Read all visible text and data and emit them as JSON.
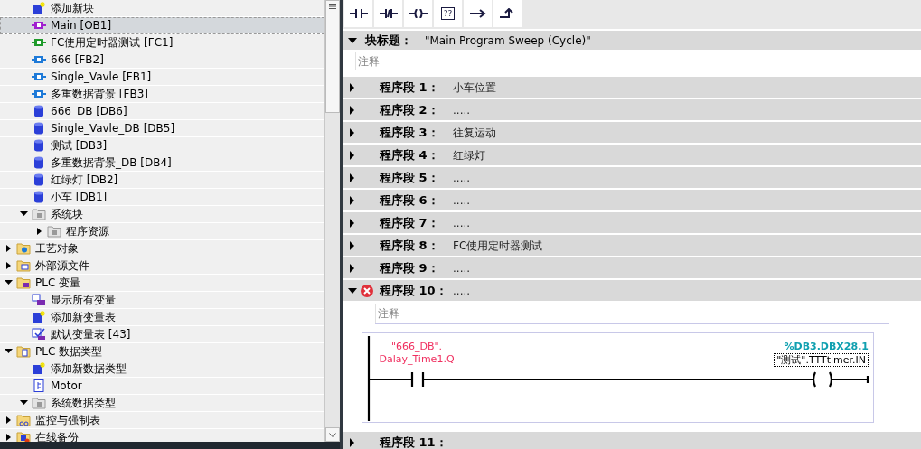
{
  "tree": {
    "partial_group": [
      {
        "kind": "add",
        "label": "添加新块",
        "selected": false
      },
      {
        "kind": "ob",
        "label": "Main [OB1]",
        "selected": true
      },
      {
        "kind": "fc",
        "label": "FC使用定时器测试 [FC1]",
        "selected": false
      },
      {
        "kind": "fb",
        "label": "666 [FB2]",
        "selected": false
      },
      {
        "kind": "fb",
        "label": "Single_Vavle [FB1]",
        "selected": false
      },
      {
        "kind": "fb",
        "label": "多重数据背景 [FB3]",
        "selected": false
      },
      {
        "kind": "db",
        "label": "666_DB [DB6]",
        "selected": false
      },
      {
        "kind": "db",
        "label": "Single_Vavle_DB [DB5]",
        "selected": false
      },
      {
        "kind": "db",
        "label": "测试 [DB3]",
        "selected": false
      },
      {
        "kind": "db",
        "label": "多重数据背景_DB [DB4]",
        "selected": false
      },
      {
        "kind": "db",
        "label": "红绿灯 [DB2]",
        "selected": false
      },
      {
        "kind": "db",
        "label": "小车 [DB1]",
        "selected": false
      },
      {
        "kind": "sysfolder",
        "label": "系统块",
        "selected": false,
        "expanded": true,
        "children": [
          {
            "kind": "sysfolder",
            "label": "程序资源",
            "selected": false,
            "expanded": false
          }
        ]
      }
    ],
    "items": [
      {
        "kind": "techfolder",
        "label": "工艺对象",
        "selected": false,
        "expanded": false
      },
      {
        "kind": "extfolder",
        "label": "外部源文件",
        "selected": false,
        "expanded": false
      },
      {
        "kind": "tagfolder",
        "label": "PLC 变量",
        "selected": false,
        "expanded": true,
        "children": [
          {
            "kind": "showtags",
            "label": "显示所有变量",
            "selected": false
          },
          {
            "kind": "add",
            "label": "添加新变量表",
            "selected": false
          },
          {
            "kind": "tagtable",
            "label": "默认变量表 [43]",
            "selected": false
          }
        ]
      },
      {
        "kind": "typefolder",
        "label": "PLC 数据类型",
        "selected": false,
        "expanded": true,
        "children": [
          {
            "kind": "add",
            "label": "添加新数据类型",
            "selected": false
          },
          {
            "kind": "type",
            "label": "Motor",
            "selected": false
          },
          {
            "kind": "systype",
            "label": "系统数据类型",
            "selected": false,
            "expanded": true
          }
        ]
      },
      {
        "kind": "watchfolder",
        "label": "监控与强制表",
        "selected": false,
        "expanded": false
      },
      {
        "kind": "backupfolder",
        "label": "在线备份",
        "selected": false,
        "expanded": false
      }
    ]
  },
  "toolbar": [
    {
      "kind": "no"
    },
    {
      "kind": "nc"
    },
    {
      "kind": "coil"
    },
    {
      "kind": "box",
      "text": "??"
    },
    {
      "kind": "branch-open"
    },
    {
      "kind": "branch-close"
    }
  ],
  "block_title": {
    "label": "块标题：",
    "value": "\"Main Program Sweep (Cycle)\"",
    "expanded": true,
    "comment_placeholder": "注释"
  },
  "networks": [
    {
      "label": "程序段 1：",
      "title": "小车位置",
      "expanded": false,
      "error": false
    },
    {
      "label": "程序段 2：",
      "title": ".....",
      "expanded": false,
      "error": false
    },
    {
      "label": "程序段 3：",
      "title": "往复运动",
      "expanded": false,
      "error": false
    },
    {
      "label": "程序段 4：",
      "title": "红绿灯",
      "expanded": false,
      "error": false
    },
    {
      "label": "程序段 5：",
      "title": ".....",
      "expanded": false,
      "error": false
    },
    {
      "label": "程序段 6：",
      "title": ".....",
      "expanded": false,
      "error": false
    },
    {
      "label": "程序段 7：",
      "title": ".....",
      "expanded": false,
      "error": false
    },
    {
      "label": "程序段 8：",
      "title": "FC使用定时器测试",
      "expanded": false,
      "error": false
    },
    {
      "label": "程序段 9：",
      "title": ".....",
      "expanded": false,
      "error": false
    },
    {
      "label": "程序段 10：",
      "title": ".....",
      "expanded": true,
      "error": true,
      "comment_placeholder": "注释",
      "ladder": {
        "contact_operand": [
          "\"666_DB\".",
          "Dalay_Time1.Q"
        ],
        "coil_address": "%DB3.DBX28.1",
        "coil_operand": "\"测试\".TTTtimer.IN"
      }
    },
    {
      "label": "程序段 11：",
      "expanded": false,
      "error": false
    }
  ]
}
